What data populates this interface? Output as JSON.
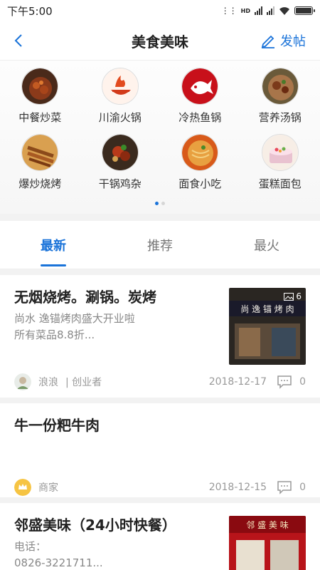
{
  "status": {
    "time": "下午5:00",
    "network": "HD"
  },
  "header": {
    "title": "美食美味",
    "post_label": "发帖"
  },
  "categories": [
    {
      "label": "中餐炒菜",
      "icon": "dish-icon"
    },
    {
      "label": "川渝火锅",
      "icon": "hotpot-icon"
    },
    {
      "label": "冷热鱼锅",
      "icon": "fish-icon"
    },
    {
      "label": "营养汤锅",
      "icon": "soup-icon"
    },
    {
      "label": "爆炒烧烤",
      "icon": "bbq-icon"
    },
    {
      "label": "干锅鸡杂",
      "icon": "drypot-icon"
    },
    {
      "label": "面食小吃",
      "icon": "noodles-icon"
    },
    {
      "label": "蛋糕面包",
      "icon": "cake-icon"
    }
  ],
  "tabs": [
    {
      "label": "最新",
      "active": true
    },
    {
      "label": "推荐",
      "active": false
    },
    {
      "label": "最火",
      "active": false
    }
  ],
  "posts": [
    {
      "title": "无烟烧烤。涮锅。炭烤",
      "desc_line1": "尚水 逸锚烤肉盛大开业啦",
      "desc_line2": "所有菜品8.8折...",
      "image_count": "6",
      "author": "浪浪",
      "role": "| 创业者",
      "date": "2018-12-17",
      "comments": "0"
    },
    {
      "title": "牛一份粑牛肉",
      "author": "商家",
      "date": "2018-12-15",
      "comments": "0"
    },
    {
      "title": "邻盛美味（24小时快餐）",
      "desc_line1": "电话：",
      "desc_line2": "0826-3221711..."
    }
  ],
  "colors": {
    "accent": "#1a73d9"
  }
}
